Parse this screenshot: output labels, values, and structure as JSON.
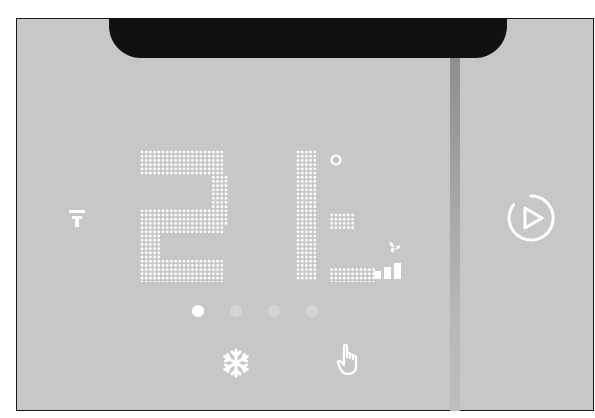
{
  "display": {
    "temperature_tens": "2",
    "temperature_units": "1",
    "degree_symbol": "°",
    "page_indicator": {
      "count": 4,
      "active_index": 0
    }
  },
  "icons": {
    "mode_left": "antenna-icon",
    "play_button": "play-circle-icon",
    "fan": "fan-icon",
    "fan_speed": "fan-speed-bars-icon",
    "cooling": "snowflake-icon",
    "manual": "hand-pointer-icon"
  },
  "colors": {
    "panel": "#c7c7c7",
    "dot_matrix": "#ffffff",
    "inactive_dot": "#d4d4d4",
    "notch": "#111111"
  }
}
